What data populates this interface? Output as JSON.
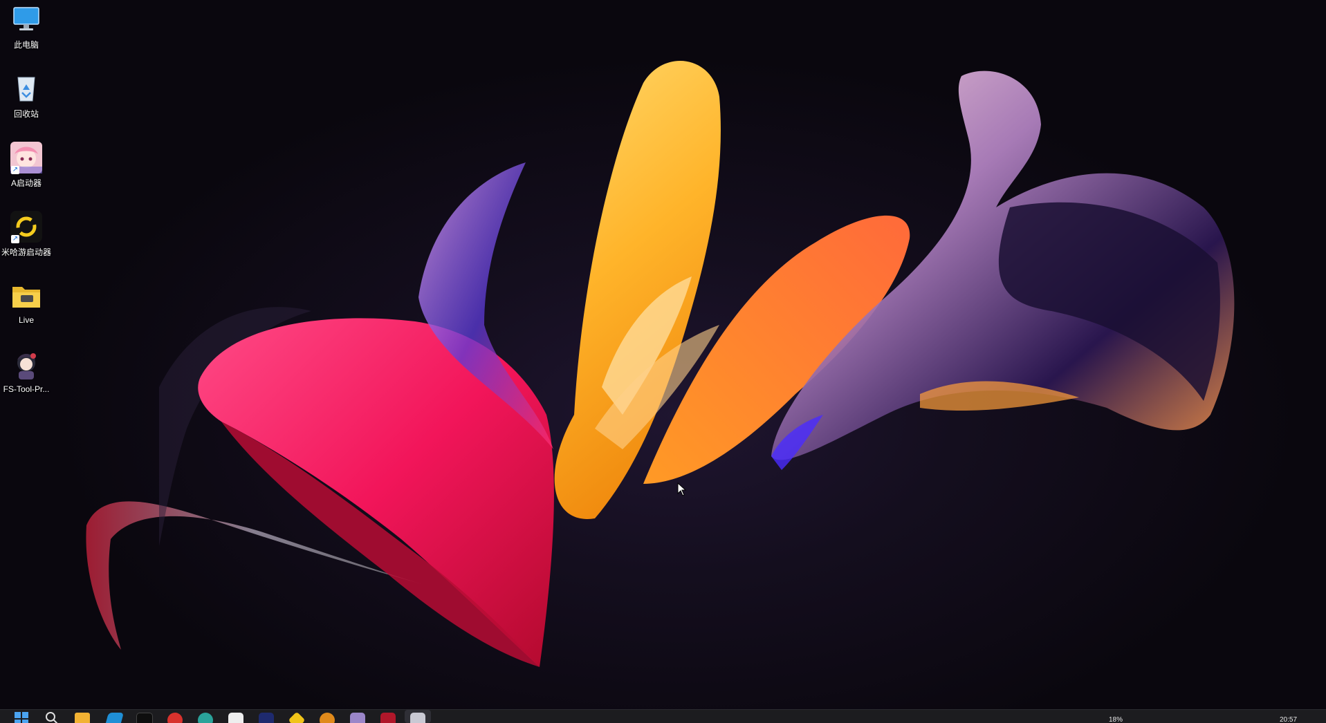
{
  "desktop": {
    "icons": [
      {
        "label": "此电脑",
        "icon": "this-pc-icon"
      },
      {
        "label": "回收站",
        "icon": "recycle-bin-icon"
      },
      {
        "label": "A启动器",
        "icon": "anime-launcher-icon"
      },
      {
        "label": "米哈游启动器",
        "icon": "mihoyo-launcher-icon"
      },
      {
        "label": "Live",
        "icon": "folder-icon"
      },
      {
        "label": "FS-Tool-Pr...",
        "icon": "fs-tool-icon"
      }
    ]
  },
  "taskbar": {
    "apps": [
      {
        "name": "start-icon",
        "color": "#3a8ee6"
      },
      {
        "name": "search-icon",
        "color": "#d0d0d0"
      },
      {
        "name": "file-explorer-icon",
        "color": "#f2b233"
      },
      {
        "name": "browser-icon",
        "color": "#1f8fd6"
      },
      {
        "name": "app-dark-icon",
        "color": "#0e0e0e"
      },
      {
        "name": "app-red-icon",
        "color": "#d8322d"
      },
      {
        "name": "app-teal-icon",
        "color": "#2aa39a"
      },
      {
        "name": "app-white-icon",
        "color": "#eeeeee"
      },
      {
        "name": "app-navy-icon",
        "color": "#1e2a6e"
      },
      {
        "name": "app-yellow-icon",
        "color": "#f0c419"
      },
      {
        "name": "app-orange-icon",
        "color": "#e08a1b"
      },
      {
        "name": "app-purple-icon",
        "color": "#9b86c9"
      },
      {
        "name": "app-crimson-icon",
        "color": "#b0172a"
      },
      {
        "name": "app-active-icon",
        "color": "#c9c9d4"
      }
    ],
    "tray": {
      "battery_percent": "18%",
      "time": "20:57"
    }
  },
  "colors": {
    "taskbar_bg": "#1c1c1f",
    "accent": "#3a8ee6"
  }
}
